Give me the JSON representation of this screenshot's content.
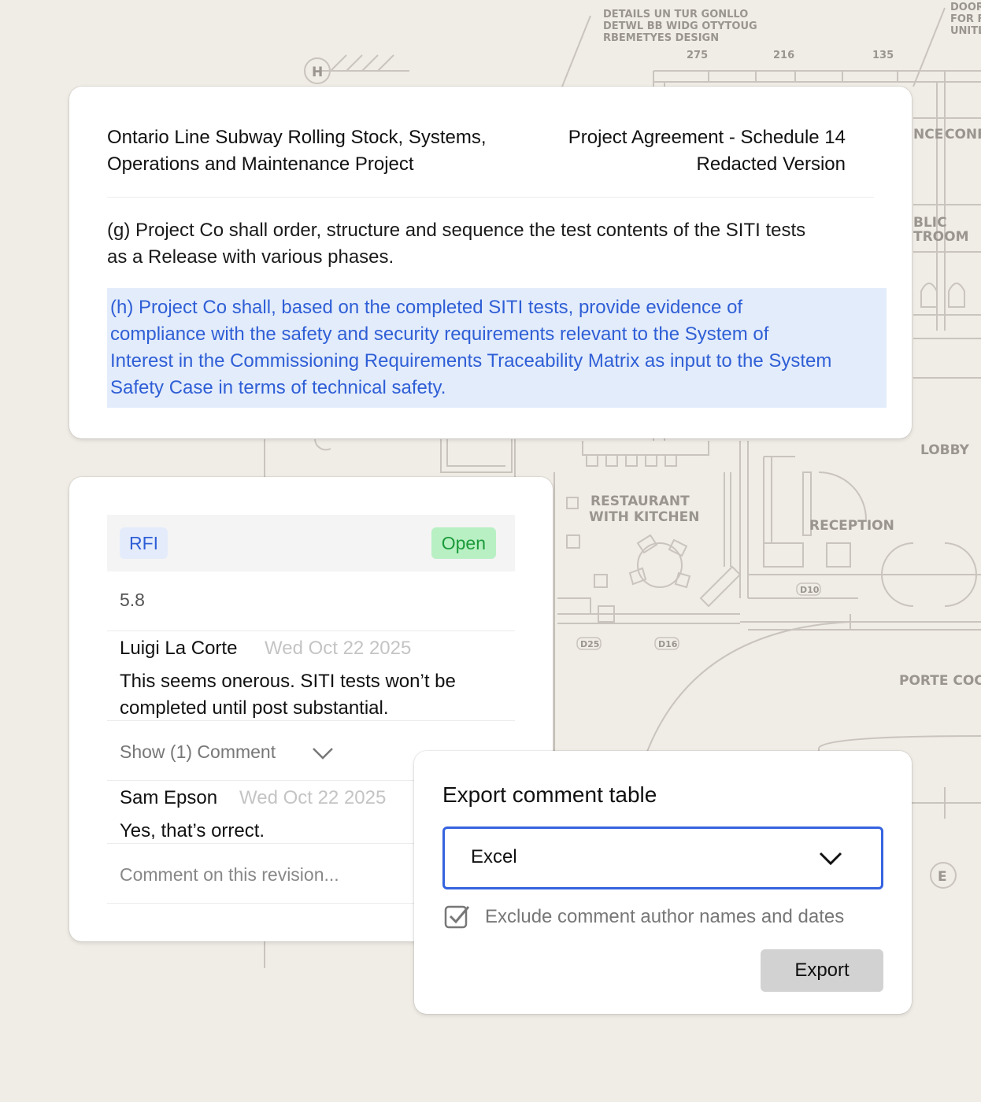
{
  "document": {
    "title_lines": [
      "Ontario Line Subway Rolling Stock, Systems,",
      "Operations and Maintenance Project"
    ],
    "meta_lines": [
      "Project Agreement - Schedule 14",
      "Redacted Version"
    ],
    "paragraph_g_lines": [
      "(g) Project Co shall order, structure and sequence the test contents of the SITI tests",
      "as a Release with various phases."
    ],
    "paragraph_h_lines": [
      "(h) Project Co shall, based on the completed SITI tests, provide evidence of",
      "compliance with the safety and security requirements relevant to the System of",
      "Interest in the Commissioning Requirements Traceability Matrix as input to the System",
      "Safety Case in terms of technical safety."
    ]
  },
  "comment_panel": {
    "type_badge": "RFI",
    "status_badge": "Open",
    "reference": "5.8",
    "comments": [
      {
        "author": "Luigi La Corte",
        "date": "Wed Oct 22 2025",
        "text_lines": [
          "This seems onerous. SITI tests won’t be",
          "completed until post substantial."
        ]
      },
      {
        "author": "Sam Epson",
        "date": "Wed Oct 22 2025",
        "text_lines": [
          "Yes, that’s orrect."
        ]
      }
    ],
    "show_replies_label": "Show (1) Comment",
    "input_placeholder": "Comment on this revision..."
  },
  "export_dialog": {
    "title": "Export comment table",
    "format_selected": "Excel",
    "exclude_label": "Exclude comment author names and dates",
    "exclude_checked": true,
    "export_button_label": "Export"
  },
  "blueprint_labels": {
    "notes": [
      "DETAILS UN TUR GONLLO",
      "DETWL BB WIDG OTYTOUG",
      "RBEMETYES DESIGN"
    ],
    "corner_note": [
      "DOOR",
      "FOR F",
      "UNITL"
    ],
    "dims": [
      "275",
      "216",
      "135"
    ],
    "grid_h": "H",
    "grid_e": "E",
    "partial_conf": "CONF",
    "partial_nce": "NCE",
    "partial_blic": "BLIC",
    "partial_troom": "TROOM",
    "lobby": "LOBBY",
    "restaurant": [
      "RESTAURANT",
      "WITH KITCHEN"
    ],
    "reception": "RECEPTION",
    "porte": "PORTE COCH",
    "tags": [
      "D10",
      "D25",
      "D16"
    ]
  },
  "colors": {
    "accent": "#3563e0",
    "highlight_bg": "#e3ecfb",
    "highlight_text": "#2f5fd6",
    "open_bg": "#b8f0c4",
    "open_text": "#1c9a3a",
    "background": "#f0ece6"
  }
}
